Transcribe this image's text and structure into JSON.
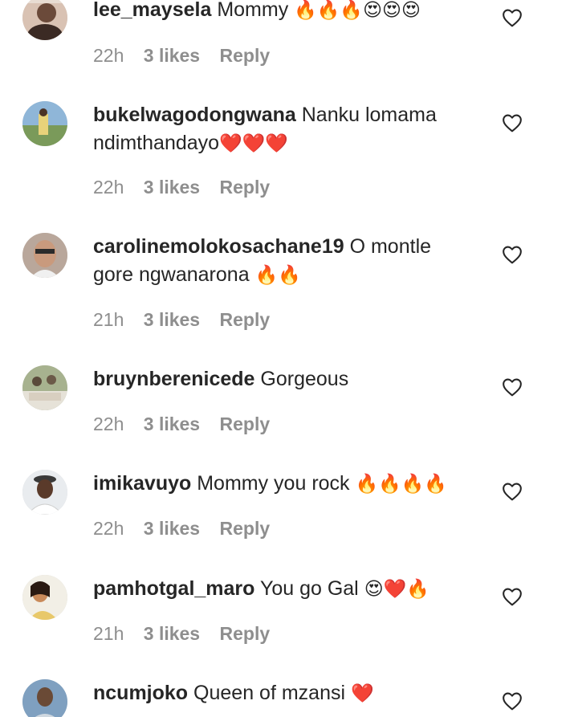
{
  "comments": [
    {
      "username": "lee_maysela",
      "text": "Mommy",
      "emojis": "🔥🔥🔥😍😍😍",
      "time": "22h",
      "likes": "3 likes",
      "reply": "Reply",
      "avatar_icon": "user-avatar-icon"
    },
    {
      "username": "bukelwagodongwana",
      "text": "Nanku lomama ndimthandayo",
      "emojis": "❤️❤️❤️",
      "time": "22h",
      "likes": "3 likes",
      "reply": "Reply",
      "avatar_icon": "user-avatar-icon"
    },
    {
      "username": "carolinemolokosachane19",
      "text": "O montle gore ngwanarona",
      "emojis": "🔥🔥",
      "time": "21h",
      "likes": "3 likes",
      "reply": "Reply",
      "avatar_icon": "user-avatar-icon"
    },
    {
      "username": "bruynberenicede",
      "text": "Gorgeous",
      "emojis": "",
      "time": "22h",
      "likes": "3 likes",
      "reply": "Reply",
      "avatar_icon": "user-avatar-icon"
    },
    {
      "username": "imikavuyo",
      "text": "Mommy you rock",
      "emojis": "🔥🔥🔥🔥",
      "time": "22h",
      "likes": "3 likes",
      "reply": "Reply",
      "avatar_icon": "user-avatar-icon"
    },
    {
      "username": "pamhotgal_maro",
      "text": "You go Gal",
      "emojis": "😍❤️🔥",
      "time": "21h",
      "likes": "3 likes",
      "reply": "Reply",
      "avatar_icon": "user-avatar-icon"
    },
    {
      "username": "ncumjoko",
      "text": "Queen of mzansi",
      "emojis": "❤️",
      "time": "",
      "likes": "",
      "reply": "",
      "avatar_icon": "user-avatar-icon"
    }
  ],
  "colors": {
    "text": "#262626",
    "meta": "#8e8e8e",
    "heart_outline": "#262626"
  },
  "like_icon": "heart-outline-icon"
}
